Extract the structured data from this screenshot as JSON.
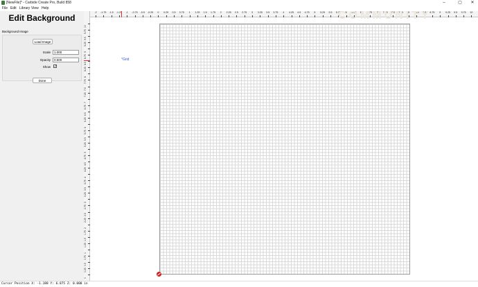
{
  "window": {
    "title": "[NewFile]* - Carbide Create Pro, Build 858",
    "minimize_glyph": "–",
    "maximize_glyph": "▢",
    "close_glyph": "✕"
  },
  "menu": [
    {
      "label": "File"
    },
    {
      "label": "Edit"
    },
    {
      "label": "Library"
    },
    {
      "label": "View"
    },
    {
      "label": "Help"
    }
  ],
  "panel": {
    "title": "Edit Background",
    "section_label": "Background Image",
    "load_button": "Load Image",
    "scale_label": "Scale",
    "scale_value": "1.000",
    "opacity_label": "Opacity",
    "opacity_value": "0.500",
    "show_label": "Show",
    "show_checked": true,
    "done_button": "Done"
  },
  "canvas": {
    "grid_label": "Grid",
    "watermark": "COMMUNITY",
    "origin_icon": "origin-marker-icon"
  },
  "ruler": {
    "h_labels": [
      "-2",
      "-1.75",
      "-1.5",
      "-1.25",
      "-1",
      "-0.75",
      "-0.5",
      "-0.25",
      "0",
      "0.25",
      "0.5",
      "0.75",
      "1",
      "1.25",
      "1.5",
      "1.75",
      "2",
      "2.25",
      "2.5",
      "2.75",
      "3",
      "3.25",
      "3.5",
      "3.75",
      "4",
      "4.25",
      "4.5",
      "4.75",
      "5",
      "5.25",
      "5.5",
      "5.75",
      "6",
      "6.25",
      "6.5",
      "6.75",
      "7",
      "7.25",
      "7.5",
      "7.75",
      "8",
      "8.25",
      "8.5",
      "8.75",
      "9",
      "9.25",
      "9.5",
      "9.75",
      "10"
    ],
    "v_labels": [
      "10",
      "9.75",
      "9.5",
      "9.25",
      "9",
      "8.75",
      "8.5",
      "8.25",
      "8",
      "7.75",
      "7.5",
      "7.25",
      "7",
      "6.75",
      "6.5",
      "6.25",
      "6",
      "5.75",
      "5.5",
      "5.25",
      "5",
      "4.75",
      "4.5",
      "4.25",
      "4",
      "3.75",
      "3.5",
      "3.25",
      "3",
      "2.75",
      "2.5",
      "2.25",
      "2",
      "1.75",
      "1.5",
      "1.25",
      "1",
      "0.75",
      "0.5",
      "0.25",
      "0"
    ],
    "accent": "#e03030"
  },
  "status": {
    "text": "Cursor Position X: -1.188 Y: 6.875 Z: 0.000 in"
  }
}
